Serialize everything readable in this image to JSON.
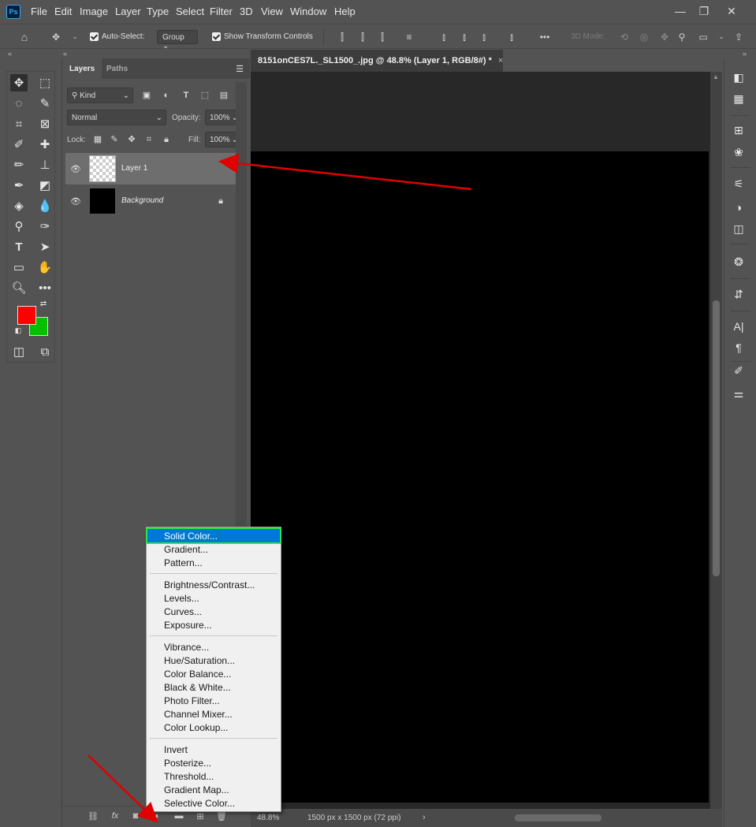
{
  "app": {
    "logo": "Ps"
  },
  "menubar": {
    "items": [
      "File",
      "Edit",
      "Image",
      "Layer",
      "Type",
      "Select",
      "Filter",
      "3D",
      "View",
      "Window",
      "Help"
    ],
    "window_controls": {
      "minimize": "—",
      "restore": "❐",
      "close": "✕"
    }
  },
  "options_bar": {
    "auto_select_label": "Auto-Select:",
    "auto_select_value": "Group",
    "show_transform_label": "Show Transform Controls",
    "mode_3d_label": "3D Mode:"
  },
  "layers_panel": {
    "tabs": [
      "Layers",
      "Paths"
    ],
    "filter_kind": "Kind",
    "blend_mode": "Normal",
    "opacity_label": "Opacity:",
    "opacity_value": "100%",
    "lock_label": "Lock:",
    "fill_label": "Fill:",
    "fill_value": "100%",
    "layers": [
      {
        "name": "Layer 1",
        "selected": true,
        "visible": true,
        "thumb": "transparent"
      },
      {
        "name": "Background",
        "selected": false,
        "visible": true,
        "thumb": "black",
        "locked": true
      }
    ],
    "footer_icons": [
      "link-icon",
      "fx-icon",
      "mask-icon",
      "adjustment-icon",
      "group-icon",
      "new-layer-icon",
      "trash-icon"
    ]
  },
  "document": {
    "tab_title": "8151onCES7L._SL1500_.jpg @ 48.8% (Layer 1, RGB/8#) *",
    "close_glyph": "×",
    "zoom": "48.8%",
    "doc_info": "1500 px x 1500 px (72 ppi)",
    "canvas_color": "#000000"
  },
  "colors": {
    "foreground": "#ff0000",
    "background": "#00c000",
    "menu_highlight": "#0078d7",
    "highlight_outline": "#2ee640",
    "arrow": "#e00000"
  },
  "adjustment_menu": {
    "groups": [
      [
        "Solid Color...",
        "Gradient...",
        "Pattern..."
      ],
      [
        "Brightness/Contrast...",
        "Levels...",
        "Curves...",
        "Exposure..."
      ],
      [
        "Vibrance...",
        "Hue/Saturation...",
        "Color Balance...",
        "Black & White...",
        "Photo Filter...",
        "Channel Mixer...",
        "Color Lookup..."
      ],
      [
        "Invert",
        "Posterize...",
        "Threshold...",
        "Gradient Map...",
        "Selective Color..."
      ]
    ],
    "highlighted": "Solid Color..."
  }
}
